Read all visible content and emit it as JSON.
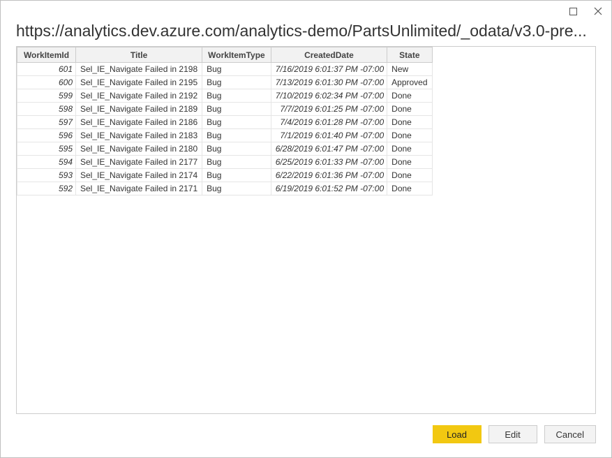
{
  "window": {
    "title": "https://analytics.dev.azure.com/analytics-demo/PartsUnlimited/_odata/v3.0-pre..."
  },
  "table": {
    "columns": [
      "WorkItemId",
      "Title",
      "WorkItemType",
      "CreatedDate",
      "State"
    ],
    "rows": [
      {
        "id": "601",
        "title": "Sel_IE_Navigate Failed in 2198",
        "type": "Bug",
        "date": "7/16/2019 6:01:37 PM -07:00",
        "state": "New"
      },
      {
        "id": "600",
        "title": "Sel_IE_Navigate Failed in 2195",
        "type": "Bug",
        "date": "7/13/2019 6:01:30 PM -07:00",
        "state": "Approved"
      },
      {
        "id": "599",
        "title": "Sel_IE_Navigate Failed in 2192",
        "type": "Bug",
        "date": "7/10/2019 6:02:34 PM -07:00",
        "state": "Done"
      },
      {
        "id": "598",
        "title": "Sel_IE_Navigate Failed in 2189",
        "type": "Bug",
        "date": "7/7/2019 6:01:25 PM -07:00",
        "state": "Done"
      },
      {
        "id": "597",
        "title": "Sel_IE_Navigate Failed in 2186",
        "type": "Bug",
        "date": "7/4/2019 6:01:28 PM -07:00",
        "state": "Done"
      },
      {
        "id": "596",
        "title": "Sel_IE_Navigate Failed in 2183",
        "type": "Bug",
        "date": "7/1/2019 6:01:40 PM -07:00",
        "state": "Done"
      },
      {
        "id": "595",
        "title": "Sel_IE_Navigate Failed in 2180",
        "type": "Bug",
        "date": "6/28/2019 6:01:47 PM -07:00",
        "state": "Done"
      },
      {
        "id": "594",
        "title": "Sel_IE_Navigate Failed in 2177",
        "type": "Bug",
        "date": "6/25/2019 6:01:33 PM -07:00",
        "state": "Done"
      },
      {
        "id": "593",
        "title": "Sel_IE_Navigate Failed in 2174",
        "type": "Bug",
        "date": "6/22/2019 6:01:36 PM -07:00",
        "state": "Done"
      },
      {
        "id": "592",
        "title": "Sel_IE_Navigate Failed in 2171",
        "type": "Bug",
        "date": "6/19/2019 6:01:52 PM -07:00",
        "state": "Done"
      }
    ]
  },
  "footer": {
    "load": "Load",
    "edit": "Edit",
    "cancel": "Cancel"
  }
}
